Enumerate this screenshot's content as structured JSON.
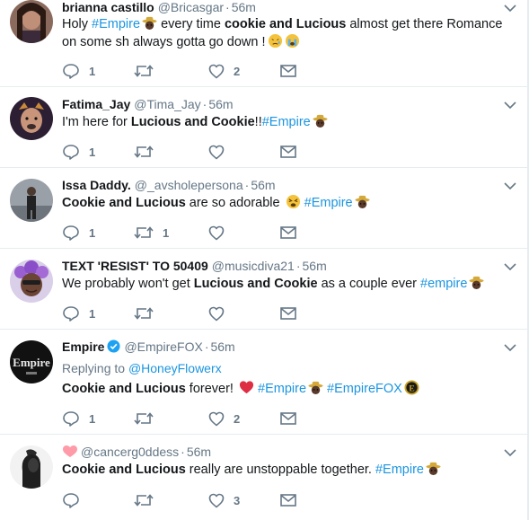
{
  "tweets": [
    {
      "display_name": "brianna castillo",
      "handle": "@Bricasgar",
      "time": "56m",
      "text_parts": [
        {
          "t": "Holy ",
          "s": "plain"
        },
        {
          "t": "#Empire",
          "s": "hashtag"
        },
        {
          "t": " every time ",
          "s": "plain"
        },
        {
          "t": "cookie and Lucious",
          "s": "bold"
        },
        {
          "t": " almost get there Romance on some sh   always gotta go down !",
          "s": "plain"
        }
      ],
      "reply_count": "1",
      "retweet_count": "",
      "like_count": "2"
    },
    {
      "display_name": "Fatima_Jay",
      "handle": "@Tima_Jay",
      "time": "56m",
      "text_parts": [
        {
          "t": "I'm here for ",
          "s": "plain"
        },
        {
          "t": "Lucious and Cookie",
          "s": "bold"
        },
        {
          "t": "!!",
          "s": "plain"
        },
        {
          "t": "#Empire",
          "s": "hashtag"
        }
      ],
      "reply_count": "1",
      "retweet_count": "",
      "like_count": ""
    },
    {
      "display_name": "Issa Daddy.",
      "handle": "@_avsholepersona",
      "time": "56m",
      "text_parts": [
        {
          "t": "Cookie and Lucious",
          "s": "bold"
        },
        {
          "t": " are so adorable ",
          "s": "plain"
        },
        {
          "t": "#Empire",
          "s": "hashtag"
        }
      ],
      "reply_count": "1",
      "retweet_count": "1",
      "like_count": ""
    },
    {
      "display_name": "TEXT 'RESIST' TO 50409",
      "handle": "@musicdiva21",
      "time": "56m",
      "text_parts": [
        {
          "t": "We probably won't get ",
          "s": "plain"
        },
        {
          "t": "Lucious and Cookie",
          "s": "bold"
        },
        {
          "t": " as a couple ever ",
          "s": "plain"
        },
        {
          "t": "#empire",
          "s": "hashtag"
        }
      ],
      "reply_count": "1",
      "retweet_count": "",
      "like_count": ""
    },
    {
      "display_name": "Empire",
      "handle": "@EmpireFOX",
      "time": "56m",
      "replying_label": "Replying to ",
      "replying_to": "@HoneyFlowerx",
      "text_parts": [
        {
          "t": "Cookie and Lucious",
          "s": "bold"
        },
        {
          "t": " forever! ",
          "s": "plain"
        },
        {
          "t": " #Empire",
          "s": "hashtag"
        },
        {
          "t": " #EmpireFOX",
          "s": "hashtag"
        }
      ],
      "reply_count": "1",
      "retweet_count": "",
      "like_count": "2"
    },
    {
      "display_name": "",
      "handle": "@cancerg0ddess",
      "time": "56m",
      "text_parts": [
        {
          "t": "Cookie and Lucious",
          "s": "bold"
        },
        {
          "t": " really are unstoppable together. ",
          "s": "plain"
        },
        {
          "t": "#Empire",
          "s": "hashtag"
        }
      ],
      "reply_count": "",
      "retweet_count": "",
      "like_count": "3"
    }
  ],
  "colors": {
    "hashtag": "#1b95e0",
    "muted": "#657786",
    "text": "#14171a",
    "divider": "#e6ecf0"
  },
  "icons": {
    "reply": "reply-icon",
    "retweet": "retweet-icon",
    "like": "heart-icon",
    "message": "envelope-icon",
    "more": "chevron-down-icon",
    "verified": "verified-badge-icon"
  }
}
